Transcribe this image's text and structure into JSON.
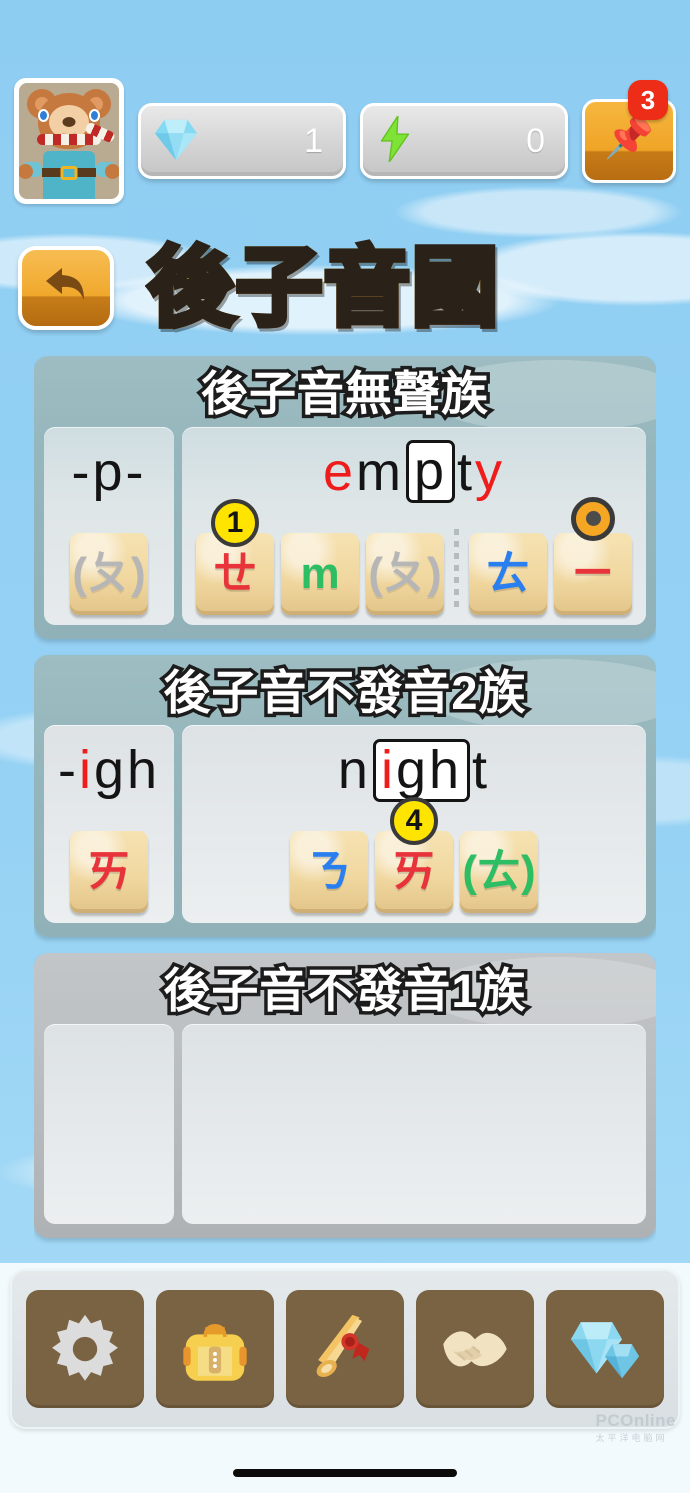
{
  "colors": {
    "sky": "#8ecdf2",
    "title_gold": "#ffd524",
    "accent_orange": "#f0a82c",
    "badge_red": "#ee2d18",
    "badge_yellow": "#ffe400",
    "letter_red": "#ef1c1c",
    "zhuyin_red": "#e8333b",
    "zhuyin_green": "#2dbd63",
    "zhuyin_blue": "#2a7ff0",
    "zhuyin_gray": "#b6b6b6",
    "card_teal": "#95b6bc",
    "dock_brown": "#7a6343"
  },
  "topbar": {
    "avatar": {
      "name": "bear-avatar"
    },
    "gem": {
      "icon": "gem-icon",
      "value": "1"
    },
    "energy": {
      "icon": "lightning-bolt-icon",
      "value": "0"
    },
    "pin": {
      "icon": "pushpin-icon",
      "badge": "3"
    }
  },
  "header": {
    "back_button_icon": "back-arrow-icon",
    "title": "後子音國"
  },
  "cards": [
    {
      "title": "後子音無聲族",
      "dim": false,
      "key_panel": {
        "word_parts": [
          {
            "text": "-",
            "color": "black",
            "boxed": false
          },
          {
            "text": "p",
            "color": "black",
            "boxed": false
          },
          {
            "text": "-",
            "color": "black",
            "boxed": false
          }
        ],
        "tiles": [
          {
            "glyph": "(ㄆ)",
            "color": "gray",
            "badge": null,
            "marker": false
          }
        ]
      },
      "word_panel": {
        "word_parts": [
          {
            "text": "e",
            "color": "red",
            "boxed": false
          },
          {
            "text": "m",
            "color": "black",
            "boxed": false
          },
          {
            "text": "p",
            "color": "black",
            "boxed": true
          },
          {
            "text": "t",
            "color": "black",
            "boxed": false
          },
          {
            "text": "y",
            "color": "red",
            "boxed": false
          }
        ],
        "tiles": [
          {
            "glyph": "ㄝ",
            "color": "red",
            "badge": "1",
            "marker": false
          },
          {
            "glyph": "m",
            "color": "green",
            "badge": null,
            "marker": false
          },
          {
            "glyph": "(ㄆ)",
            "color": "gray",
            "badge": null,
            "marker": false
          },
          {
            "separator": true
          },
          {
            "glyph": "ㄊ",
            "color": "blue",
            "badge": null,
            "marker": false
          },
          {
            "glyph": "ㄧ",
            "color": "red",
            "badge": null,
            "marker": true
          }
        ]
      }
    },
    {
      "title": "後子音不發音2族",
      "dim": false,
      "key_panel": {
        "word_parts": [
          {
            "text": "-",
            "color": "black",
            "boxed": false
          },
          {
            "text": "i",
            "color": "red",
            "boxed": false
          },
          {
            "text": "g",
            "color": "black",
            "boxed": false
          },
          {
            "text": "h",
            "color": "black",
            "boxed": false
          }
        ],
        "tiles": [
          {
            "glyph": "ㄞ",
            "color": "red",
            "badge": null,
            "marker": false
          }
        ]
      },
      "word_panel": {
        "word_parts": [
          {
            "text": "n",
            "color": "black",
            "boxed": false
          },
          {
            "text": "igh",
            "color": "mixed-igh",
            "boxed": true
          },
          {
            "text": "t",
            "color": "black",
            "boxed": false
          }
        ],
        "tiles": [
          {
            "glyph": "ㄋ",
            "color": "blue",
            "badge": null,
            "marker": false
          },
          {
            "glyph": "ㄞ",
            "color": "red",
            "badge": "4",
            "marker": false
          },
          {
            "glyph": "(ㄊ)",
            "color": "green",
            "badge": null,
            "marker": false
          }
        ]
      }
    },
    {
      "title": "後子音不發音1族",
      "dim": true,
      "key_panel": {
        "word_parts": [],
        "tiles": []
      },
      "word_panel": {
        "word_parts": [],
        "tiles": []
      }
    }
  ],
  "dock": {
    "items": [
      {
        "icon": "gear-icon",
        "name": "settings-button"
      },
      {
        "icon": "backpack-icon",
        "name": "inventory-button"
      },
      {
        "icon": "scroll-icon",
        "name": "achievements-button"
      },
      {
        "icon": "handshake-icon",
        "name": "friends-button"
      },
      {
        "icon": "diamonds-icon",
        "name": "shop-button"
      }
    ]
  },
  "watermark": {
    "text": "PCOnline",
    "sub": "太平洋电脑网"
  }
}
